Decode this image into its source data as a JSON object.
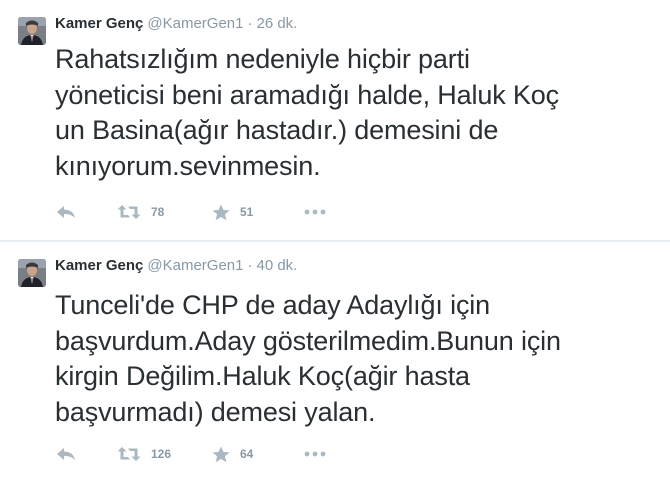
{
  "tweets": [
    {
      "fullname": "Kamer Genç",
      "username": "@KamerGen1",
      "separator": "·",
      "time": "26 dk.",
      "text": "Rahatsızlığım nedeniyle hiçbir parti\nyöneticisi beni aramadığı halde, Haluk Koç\nun Basina(ağır hastadır.) demesini de\nkınıyorum.sevinmesin.",
      "retweets": "78",
      "favorites": "51"
    },
    {
      "fullname": "Kamer Genç",
      "username": "@KamerGen1",
      "separator": "·",
      "time": "40 dk.",
      "text": "Tunceli'de CHP de aday Adaylığı için\nbaşvurdum.Aday gösterilmedim.Bunun için\nkirgin Değilim.Haluk Koç(ağir hasta\nbaşvurmadı) demesi yalan.",
      "retweets": "126",
      "favorites": "64"
    }
  ],
  "icons": {
    "reply": "reply-icon",
    "retweet": "retweet-icon",
    "favorite": "star-icon",
    "more": "more-icon",
    "avatar": "profile-photo"
  },
  "colors": {
    "text": "#292f33",
    "muted": "#8899a6",
    "icon": "#aab8c2",
    "divider": "#e6ecf0"
  }
}
